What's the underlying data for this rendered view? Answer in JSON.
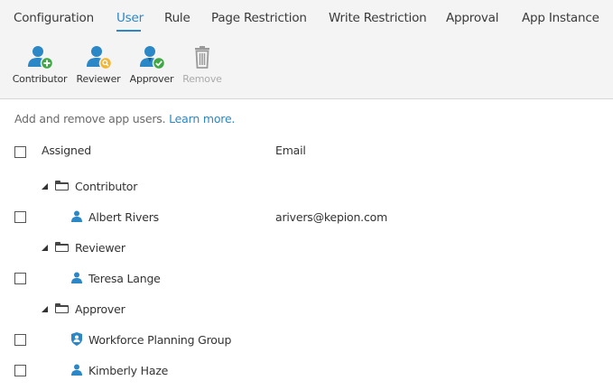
{
  "tabs": [
    {
      "label": "Configuration"
    },
    {
      "label": "User"
    },
    {
      "label": "Rule"
    },
    {
      "label": "Page Restriction"
    },
    {
      "label": "Write Restriction"
    },
    {
      "label": "Approval"
    },
    {
      "label": "App Instance"
    }
  ],
  "active_tab": "User",
  "toolbar": {
    "contributor": "Contributor",
    "reviewer": "Reviewer",
    "approver": "Approver",
    "remove": "Remove"
  },
  "intro": {
    "text": "Add and remove app users.",
    "link": "Learn more."
  },
  "table": {
    "col_assigned": "Assigned",
    "col_email": "Email",
    "groups": [
      {
        "name": "Contributor",
        "members": [
          {
            "name": "Albert Rivers",
            "email": "arivers@kepion.com",
            "icon": "user-icon"
          }
        ]
      },
      {
        "name": "Reviewer",
        "members": [
          {
            "name": "Teresa Lange",
            "email": "",
            "icon": "user-icon"
          }
        ]
      },
      {
        "name": "Approver",
        "members": [
          {
            "name": "Workforce Planning Group",
            "email": "",
            "icon": "group-badge-icon"
          },
          {
            "name": "Kimberly Haze",
            "email": "",
            "icon": "user-icon"
          }
        ]
      }
    ]
  },
  "colors": {
    "accent": "#2b87c5",
    "add_badge": "#3fa845",
    "search_badge": "#f2b632",
    "check_badge": "#3fa845",
    "disabled": "#aaaaaa"
  }
}
